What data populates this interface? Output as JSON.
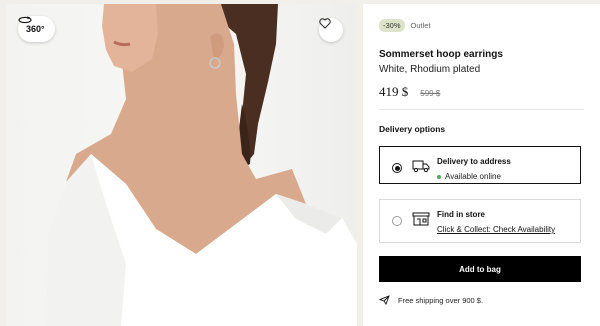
{
  "gallery": {
    "view360_label": "360°"
  },
  "product": {
    "discount_badge": "-30%",
    "outlet_label": "Outlet",
    "name": "Sommerset hoop earrings",
    "variant": "White, Rhodium plated",
    "price": "419 $",
    "old_price": "599 $"
  },
  "delivery": {
    "heading": "Delivery options",
    "options": [
      {
        "title": "Delivery to address",
        "status": "Available online",
        "selected": true
      },
      {
        "title": "Find in store",
        "link": "Click & Collect: Check Availability",
        "selected": false
      }
    ]
  },
  "actions": {
    "add_to_bag": "Add to bag"
  },
  "shipping_note": "Free shipping over 900 $.",
  "colors": {
    "discount_badge_bg": "#dde3c8",
    "availability_dot": "#4caf50",
    "primary_button": "#000000"
  }
}
